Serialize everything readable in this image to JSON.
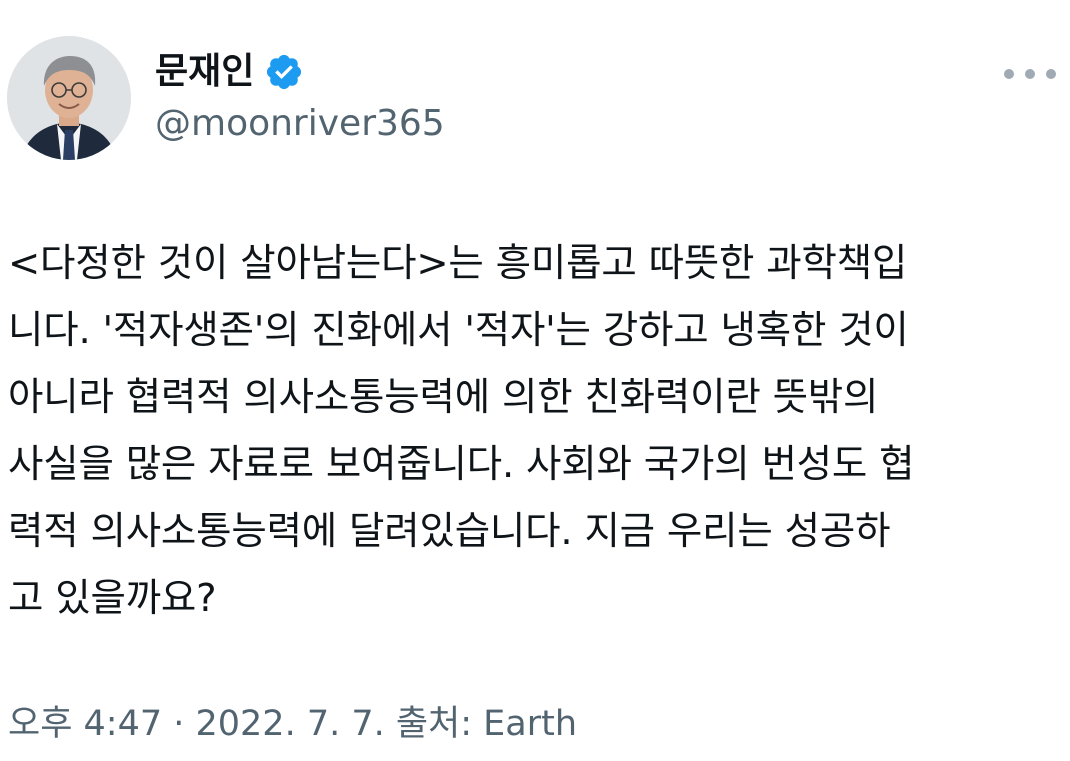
{
  "author": {
    "display_name": "문재인",
    "handle": "@moonriver365",
    "verified": true,
    "verified_color": "#1d9bf0"
  },
  "more_icon": "more-horizontal-icon",
  "tweet": {
    "lines": [
      "<다정한 것이 살아남는다>는 흥미롭고 따뜻한 과학책입",
      "니다. '적자생존'의 진화에서 '적자'는 강하고 냉혹한 것이",
      "아니라 협력적 의사소통능력에 의한 친화력이란 뜻밖의",
      "사실을 많은 자료로 보여줍니다. 사회와 국가의 번성도 협",
      "력적 의사소통능력에 달려있습니다. 지금 우리는 성공하",
      "고 있을까요?"
    ]
  },
  "meta": {
    "timestamp_line": "오후 4:47 · 2022. 7. 7. 출처: Earth"
  }
}
